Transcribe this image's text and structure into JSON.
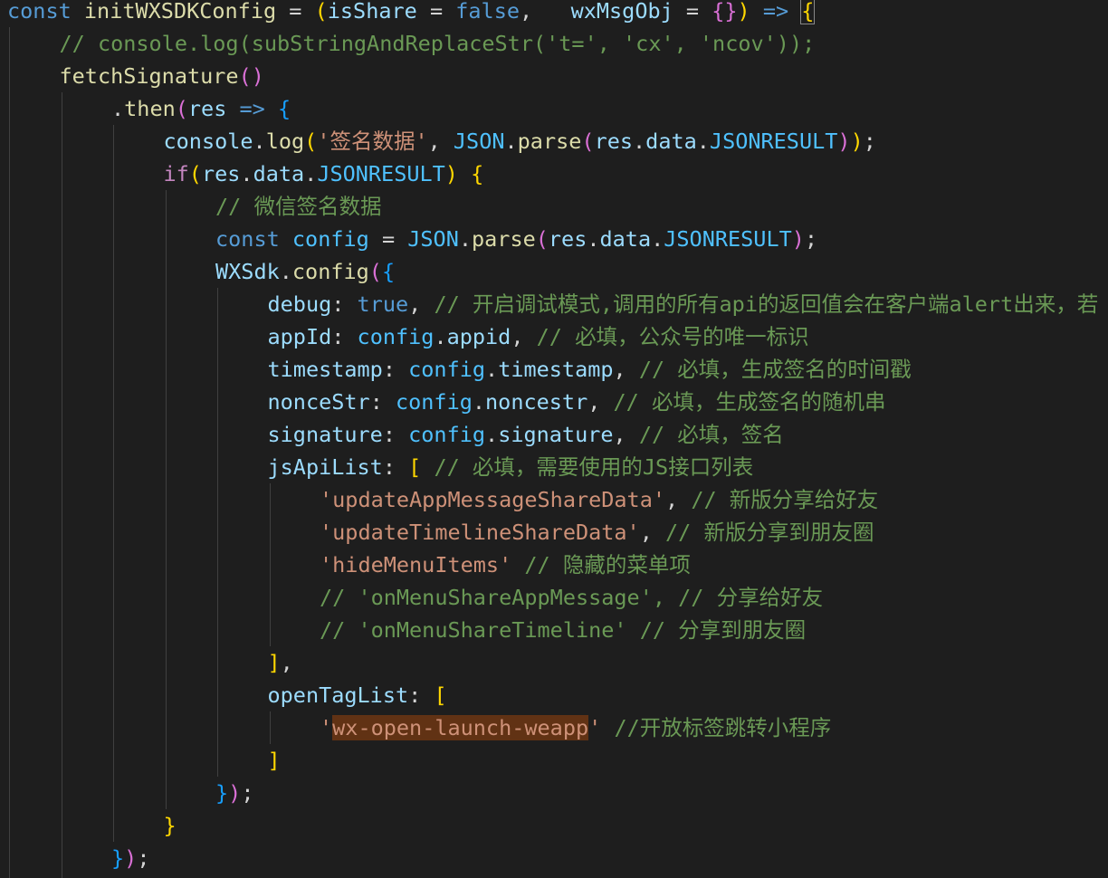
{
  "editor": {
    "language": "javascript",
    "theme_colors": {
      "background": "#1e1e1e",
      "keyword": "#569cd6",
      "function": "#dcdcaa",
      "variable": "#9cdcfe",
      "constant": "#4fc1ff",
      "string": "#ce9178",
      "comment": "#6a9955",
      "control": "#c586c0",
      "bracket_level_1": "#ffd700",
      "bracket_level_2": "#da70d6",
      "bracket_level_3": "#179fff",
      "selection_highlight": "#613214"
    },
    "lines": [
      {
        "indent": 0,
        "tokens": [
          {
            "t": "const",
            "c": "keyword"
          },
          {
            "t": " "
          },
          {
            "t": "initWXSDKConfig",
            "c": "function"
          },
          {
            "t": " = "
          },
          {
            "t": "(",
            "c": "b1"
          },
          {
            "t": "isShare",
            "c": "variable"
          },
          {
            "t": " = "
          },
          {
            "t": "false",
            "c": "keyword"
          },
          {
            "t": ",   "
          },
          {
            "t": "wxMsgObj",
            "c": "variable"
          },
          {
            "t": " = "
          },
          {
            "t": "{}",
            "c": "b2"
          },
          {
            "t": ")",
            "c": "b1"
          },
          {
            "t": " "
          },
          {
            "t": "=>",
            "c": "keyword"
          },
          {
            "t": " "
          },
          {
            "t": "{",
            "c": "b1",
            "cursor": true
          }
        ]
      },
      {
        "indent": 1,
        "tokens": [
          {
            "t": "// console.log(subStringAndReplaceStr('t=', 'cx', 'ncov'));",
            "c": "comment"
          }
        ]
      },
      {
        "indent": 1,
        "tokens": [
          {
            "t": "fetchSignature",
            "c": "function"
          },
          {
            "t": "()",
            "c": "b2"
          }
        ]
      },
      {
        "indent": 2,
        "tokens": [
          {
            "t": "."
          },
          {
            "t": "then",
            "c": "function"
          },
          {
            "t": "(",
            "c": "b2"
          },
          {
            "t": "res",
            "c": "variable"
          },
          {
            "t": " "
          },
          {
            "t": "=>",
            "c": "keyword"
          },
          {
            "t": " "
          },
          {
            "t": "{",
            "c": "b3"
          }
        ]
      },
      {
        "indent": 3,
        "tokens": [
          {
            "t": "console",
            "c": "variable"
          },
          {
            "t": "."
          },
          {
            "t": "log",
            "c": "function"
          },
          {
            "t": "(",
            "c": "b1"
          },
          {
            "t": "'签名数据'",
            "c": "string"
          },
          {
            "t": ", "
          },
          {
            "t": "JSON",
            "c": "constant"
          },
          {
            "t": "."
          },
          {
            "t": "parse",
            "c": "function"
          },
          {
            "t": "(",
            "c": "b2"
          },
          {
            "t": "res",
            "c": "variable"
          },
          {
            "t": "."
          },
          {
            "t": "data",
            "c": "variable"
          },
          {
            "t": "."
          },
          {
            "t": "JSONRESULT",
            "c": "constant"
          },
          {
            "t": ")",
            "c": "b2"
          },
          {
            "t": ")",
            "c": "b1"
          },
          {
            "t": ";"
          }
        ]
      },
      {
        "indent": 3,
        "tokens": [
          {
            "t": "if",
            "c": "control"
          },
          {
            "t": "(",
            "c": "b1"
          },
          {
            "t": "res",
            "c": "variable"
          },
          {
            "t": "."
          },
          {
            "t": "data",
            "c": "variable"
          },
          {
            "t": "."
          },
          {
            "t": "JSONRESULT",
            "c": "constant"
          },
          {
            "t": ")",
            "c": "b1"
          },
          {
            "t": " "
          },
          {
            "t": "{",
            "c": "b1"
          }
        ]
      },
      {
        "indent": 4,
        "tokens": [
          {
            "t": "// 微信签名数据",
            "c": "comment"
          }
        ]
      },
      {
        "indent": 4,
        "tokens": [
          {
            "t": "const",
            "c": "keyword"
          },
          {
            "t": " "
          },
          {
            "t": "config",
            "c": "constant"
          },
          {
            "t": " = "
          },
          {
            "t": "JSON",
            "c": "constant"
          },
          {
            "t": "."
          },
          {
            "t": "parse",
            "c": "function"
          },
          {
            "t": "(",
            "c": "b2"
          },
          {
            "t": "res",
            "c": "variable"
          },
          {
            "t": "."
          },
          {
            "t": "data",
            "c": "variable"
          },
          {
            "t": "."
          },
          {
            "t": "JSONRESULT",
            "c": "constant"
          },
          {
            "t": ")",
            "c": "b2"
          },
          {
            "t": ";"
          }
        ]
      },
      {
        "indent": 4,
        "tokens": [
          {
            "t": "WXSdk",
            "c": "variable"
          },
          {
            "t": "."
          },
          {
            "t": "config",
            "c": "function"
          },
          {
            "t": "(",
            "c": "b2"
          },
          {
            "t": "{",
            "c": "b3"
          }
        ]
      },
      {
        "indent": 5,
        "tokens": [
          {
            "t": "debug",
            "c": "variable"
          },
          {
            "t": ": "
          },
          {
            "t": "true",
            "c": "keyword"
          },
          {
            "t": ", "
          },
          {
            "t": "// 开启调试模式,调用的所有api的返回值会在客户端alert出来，若",
            "c": "comment"
          }
        ]
      },
      {
        "indent": 5,
        "tokens": [
          {
            "t": "appId",
            "c": "variable"
          },
          {
            "t": ": "
          },
          {
            "t": "config",
            "c": "constant"
          },
          {
            "t": "."
          },
          {
            "t": "appid",
            "c": "variable"
          },
          {
            "t": ", "
          },
          {
            "t": "// 必填，公众号的唯一标识",
            "c": "comment"
          }
        ]
      },
      {
        "indent": 5,
        "tokens": [
          {
            "t": "timestamp",
            "c": "variable"
          },
          {
            "t": ": "
          },
          {
            "t": "config",
            "c": "constant"
          },
          {
            "t": "."
          },
          {
            "t": "timestamp",
            "c": "variable"
          },
          {
            "t": ", "
          },
          {
            "t": "// 必填，生成签名的时间戳",
            "c": "comment"
          }
        ]
      },
      {
        "indent": 5,
        "tokens": [
          {
            "t": "nonceStr",
            "c": "variable"
          },
          {
            "t": ": "
          },
          {
            "t": "config",
            "c": "constant"
          },
          {
            "t": "."
          },
          {
            "t": "noncestr",
            "c": "variable"
          },
          {
            "t": ", "
          },
          {
            "t": "// 必填，生成签名的随机串",
            "c": "comment"
          }
        ]
      },
      {
        "indent": 5,
        "tokens": [
          {
            "t": "signature",
            "c": "variable"
          },
          {
            "t": ": "
          },
          {
            "t": "config",
            "c": "constant"
          },
          {
            "t": "."
          },
          {
            "t": "signature",
            "c": "variable"
          },
          {
            "t": ", "
          },
          {
            "t": "// 必填，签名",
            "c": "comment"
          }
        ]
      },
      {
        "indent": 5,
        "tokens": [
          {
            "t": "jsApiList",
            "c": "variable"
          },
          {
            "t": ": "
          },
          {
            "t": "[",
            "c": "b1"
          },
          {
            "t": " "
          },
          {
            "t": "// 必填，需要使用的JS接口列表",
            "c": "comment"
          }
        ]
      },
      {
        "indent": 6,
        "tokens": [
          {
            "t": "'updateAppMessageShareData'",
            "c": "string"
          },
          {
            "t": ", "
          },
          {
            "t": "// 新版分享给好友",
            "c": "comment"
          }
        ]
      },
      {
        "indent": 6,
        "tokens": [
          {
            "t": "'updateTimelineShareData'",
            "c": "string"
          },
          {
            "t": ", "
          },
          {
            "t": "// 新版分享到朋友圈",
            "c": "comment"
          }
        ]
      },
      {
        "indent": 6,
        "tokens": [
          {
            "t": "'hideMenuItems'",
            "c": "string"
          },
          {
            "t": " "
          },
          {
            "t": "// 隐藏的菜单项",
            "c": "comment"
          }
        ]
      },
      {
        "indent": 6,
        "tokens": [
          {
            "t": "// 'onMenuShareAppMessage', // 分享给好友",
            "c": "comment"
          }
        ]
      },
      {
        "indent": 6,
        "tokens": [
          {
            "t": "// 'onMenuShareTimeline' // 分享到朋友圈",
            "c": "comment"
          }
        ]
      },
      {
        "indent": 5,
        "tokens": [
          {
            "t": "]",
            "c": "b1"
          },
          {
            "t": ","
          }
        ]
      },
      {
        "indent": 5,
        "tokens": [
          {
            "t": "openTagList",
            "c": "variable"
          },
          {
            "t": ": "
          },
          {
            "t": "[",
            "c": "b1"
          }
        ]
      },
      {
        "indent": 6,
        "tokens": [
          {
            "t": "'",
            "c": "string"
          },
          {
            "t": "wx-open-launch-weapp",
            "c": "string",
            "selected": true
          },
          {
            "t": "'",
            "c": "string"
          },
          {
            "t": " "
          },
          {
            "t": "//开放标签跳转小程序",
            "c": "comment"
          }
        ]
      },
      {
        "indent": 5,
        "tokens": [
          {
            "t": "]",
            "c": "b1"
          }
        ]
      },
      {
        "indent": 4,
        "tokens": [
          {
            "t": "}",
            "c": "b3"
          },
          {
            "t": ")",
            "c": "b2"
          },
          {
            "t": ";"
          }
        ]
      },
      {
        "indent": 3,
        "tokens": [
          {
            "t": "}",
            "c": "b1"
          }
        ]
      },
      {
        "indent": 2,
        "tokens": [
          {
            "t": "}",
            "c": "b3"
          },
          {
            "t": ")",
            "c": "b2"
          },
          {
            "t": ";"
          }
        ]
      },
      {
        "indent": 2,
        "tokens": [
          {
            "t": ""
          }
        ]
      }
    ]
  }
}
